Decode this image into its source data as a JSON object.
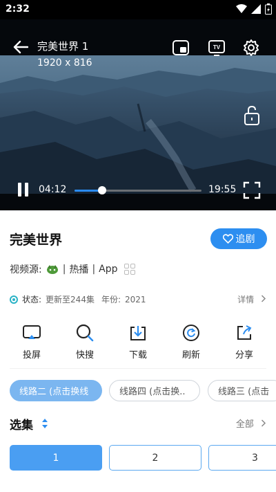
{
  "status_bar": {
    "time": "2:32"
  },
  "player": {
    "title": "完美世界 1",
    "resolution": "1920 x 816",
    "current_time": "04:12",
    "duration": "19:55",
    "progress": 0.22
  },
  "show": {
    "title": "完美世界",
    "follow_label": "追剧",
    "source_label": "视频源:",
    "source_name": "热播",
    "source_app": "App",
    "status_label": "状态:",
    "status_value": "更新至244集",
    "year_label": "年份:",
    "year_value": "2021",
    "details_label": "详情"
  },
  "actions": [
    {
      "label": "投屏",
      "icon": "cast-icon"
    },
    {
      "label": "快搜",
      "icon": "search-icon"
    },
    {
      "label": "下载",
      "icon": "download-icon"
    },
    {
      "label": "刷新",
      "icon": "refresh-icon"
    },
    {
      "label": "分享",
      "icon": "share-icon"
    }
  ],
  "lines": [
    {
      "label": "线路二 (点击换线",
      "active": true
    },
    {
      "label": "线路四 (点击换..",
      "active": false
    },
    {
      "label": "线路三 (点击",
      "active": false
    }
  ],
  "episodes": {
    "title": "选集",
    "all_label": "全部",
    "items": [
      "1",
      "2",
      "3"
    ]
  },
  "colors": {
    "accent": "#2d8ef0",
    "active_chip": "#7bb6f0",
    "status_teal": "#2ab3c6"
  }
}
